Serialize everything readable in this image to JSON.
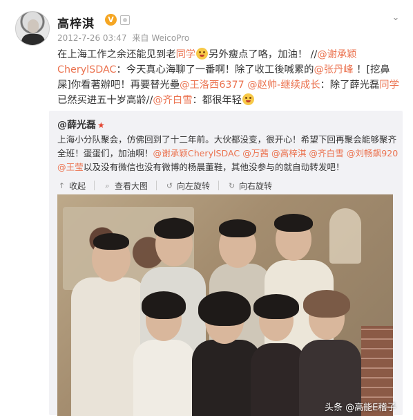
{
  "post": {
    "username": "高梓淇",
    "verified_badge": "V",
    "timestamp": "2012-7-26 03:47",
    "source_prefix": "来自",
    "source": "WeicoPro",
    "text_parts": [
      {
        "t": "在上海工作之余还能见到老",
        "link": false
      },
      {
        "t": "同学",
        "link": true
      },
      {
        "t": "EMOJI",
        "link": false
      },
      {
        "t": "另外瘦点了咯，加油！ //",
        "link": false
      },
      {
        "t": "@谢承颖CherylSDAC",
        "link": true
      },
      {
        "t": "：今天真心海聊了一番啊！除了收工後喊累的",
        "link": false
      },
      {
        "t": "@张丹峰",
        "link": true
      },
      {
        "t": " ！[挖鼻屎]你看著辦吧！再要替光壘",
        "link": false
      },
      {
        "t": "@王洛西6377",
        "link": true
      },
      {
        "t": " ",
        "link": false
      },
      {
        "t": "@赵帅-继续成长",
        "link": true
      },
      {
        "t": "：除了薛光磊",
        "link": false
      },
      {
        "t": "同学",
        "link": true
      },
      {
        "t": "已然买进五十岁高龄//",
        "link": false
      },
      {
        "t": "@齐白雪",
        "link": true
      },
      {
        "t": "：都很年轻",
        "link": false
      },
      {
        "t": "EMOJI",
        "link": false
      }
    ]
  },
  "repost": {
    "username": "@薛光磊",
    "text_parts": [
      {
        "t": "上海小分队聚会，仿佛回到了十二年前。大伙都没变，很开心！希望下回再聚会能够聚齐全班！蛋蛋们，加油啊！",
        "link": false
      },
      {
        "t": "@谢承颖CherylSDAC",
        "link": true
      },
      {
        "t": " ",
        "link": false
      },
      {
        "t": "@万茜",
        "link": true
      },
      {
        "t": " ",
        "link": false
      },
      {
        "t": "@高梓淇",
        "link": true
      },
      {
        "t": " ",
        "link": false
      },
      {
        "t": "@齐白雪",
        "link": true
      },
      {
        "t": " ",
        "link": false
      },
      {
        "t": "@刘畅飙920",
        "link": true
      },
      {
        "t": " ",
        "link": false
      },
      {
        "t": "@王莹",
        "link": true
      },
      {
        "t": "以及没有微信也没有微博的杨晨董鞋，其他没参与的就自动转发吧！",
        "link": false
      }
    ],
    "actions": {
      "collapse": "收起",
      "view_large": "查看大图",
      "rotate_left": "向左旋转",
      "rotate_right": "向右旋转"
    },
    "photo_alt": "group photo"
  },
  "watermark": "头条 @高能E稽子",
  "colors": {
    "link": "#eb7350",
    "repost_bg": "#f2f2f5"
  }
}
